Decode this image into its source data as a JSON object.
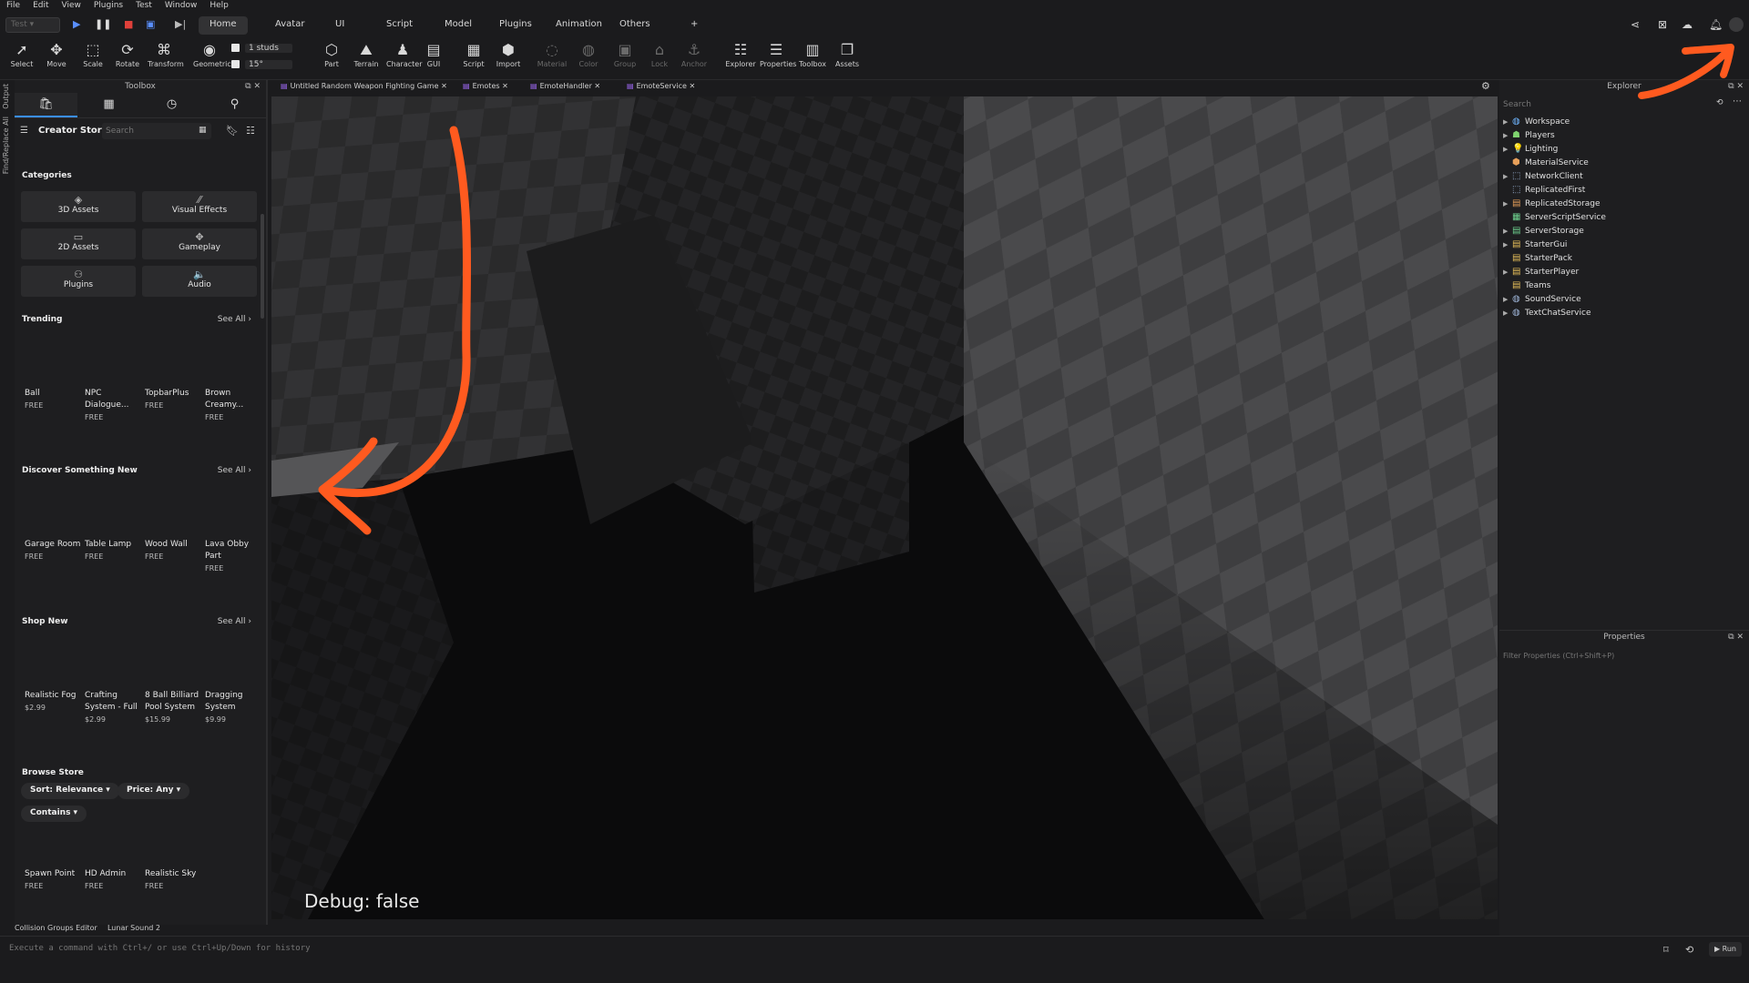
{
  "menu": [
    "File",
    "Edit",
    "View",
    "Plugins",
    "Test",
    "Window",
    "Help"
  ],
  "mode_select": "Test",
  "ribbon_tabs": [
    "Home",
    "Avatar",
    "UI",
    "Script",
    "Model",
    "Plugins",
    "Animation",
    "Others",
    "+"
  ],
  "active_ribbon_tab": "Home",
  "tools": [
    {
      "label": "Select",
      "icon": "select-arrow-icon",
      "glyph": "➚"
    },
    {
      "label": "Move",
      "icon": "move-icon",
      "glyph": "✥"
    },
    {
      "label": "Scale",
      "icon": "scale-icon",
      "glyph": "⬚"
    },
    {
      "label": "Rotate",
      "icon": "rotate-icon",
      "glyph": "⟳"
    },
    {
      "label": "Transform",
      "icon": "transform-icon",
      "glyph": "⌘"
    },
    {
      "label": "Geometric",
      "icon": "geometric-icon",
      "glyph": "◉"
    }
  ],
  "snap": {
    "move": "1 studs",
    "rotate": "15°"
  },
  "tools2": [
    {
      "label": "Part",
      "icon": "part-cube-icon",
      "glyph": "⬡",
      "dim": false
    },
    {
      "label": "Terrain",
      "icon": "terrain-icon",
      "glyph": "⛰",
      "dim": false
    },
    {
      "label": "Character",
      "icon": "character-icon",
      "glyph": "♟",
      "dim": false
    },
    {
      "label": "GUI",
      "icon": "gui-icon",
      "glyph": "▤",
      "dim": false
    },
    {
      "label": "Script",
      "icon": "script-icon",
      "glyph": "▦",
      "dim": false
    },
    {
      "label": "Import",
      "icon": "import-icon",
      "glyph": "⬢",
      "dim": false
    },
    {
      "label": "Material",
      "icon": "material-icon",
      "glyph": "◌",
      "dim": true
    },
    {
      "label": "Color",
      "icon": "color-icon",
      "glyph": "◍",
      "dim": true
    },
    {
      "label": "Group",
      "icon": "group-icon",
      "glyph": "▣",
      "dim": true
    },
    {
      "label": "Lock",
      "icon": "lock-icon",
      "glyph": "⌂",
      "dim": true
    },
    {
      "label": "Anchor",
      "icon": "anchor-icon",
      "glyph": "⚓",
      "dim": true
    },
    {
      "label": "Explorer",
      "icon": "explorer-icon",
      "glyph": "☷",
      "dim": false
    },
    {
      "label": "Properties",
      "icon": "properties-icon",
      "glyph": "☰",
      "dim": false
    },
    {
      "label": "Toolbox",
      "icon": "toolbox-icon",
      "glyph": "▥",
      "dim": false
    },
    {
      "label": "Assets",
      "icon": "assets-icon",
      "glyph": "❐",
      "dim": false
    }
  ],
  "left_rail": [
    "Output",
    "Find/Replace All"
  ],
  "toolbox": {
    "title": "Toolbox",
    "store_title": "Creator Store",
    "search_placeholder": "Search",
    "categories_title": "Categories",
    "categories": [
      {
        "label": "3D Assets",
        "icon": "cube-icon",
        "glyph": "◈"
      },
      {
        "label": "Visual Effects",
        "icon": "sparkle-icon",
        "glyph": "⁄⁄"
      },
      {
        "label": "2D Assets",
        "icon": "image-icon",
        "glyph": "▭"
      },
      {
        "label": "Gameplay",
        "icon": "gameplay-icon",
        "glyph": "✥"
      },
      {
        "label": "Plugins",
        "icon": "plugin-icon",
        "glyph": "⚇"
      },
      {
        "label": "Audio",
        "icon": "audio-icon",
        "glyph": "🔈"
      }
    ],
    "see_all": "See All",
    "sections": [
      {
        "title": "Trending",
        "items": [
          {
            "name": "Ball",
            "price": "FREE"
          },
          {
            "name": "NPC Dialogue...",
            "price": "FREE"
          },
          {
            "name": "TopbarPlus",
            "price": "FREE"
          },
          {
            "name": "Brown Creamy...",
            "price": "FREE"
          }
        ]
      },
      {
        "title": "Discover Something New",
        "items": [
          {
            "name": "Garage Room",
            "price": "FREE"
          },
          {
            "name": "Table Lamp",
            "price": "FREE"
          },
          {
            "name": "Wood Wall",
            "price": "FREE"
          },
          {
            "name": "Lava Obby Part",
            "price": "FREE"
          }
        ]
      },
      {
        "title": "Shop New",
        "items": [
          {
            "name": "Realistic Fog",
            "price": "$2.99"
          },
          {
            "name": "Crafting System - Full",
            "price": "$2.99"
          },
          {
            "name": "8 Ball Billiard Pool System",
            "price": "$15.99"
          },
          {
            "name": "Dragging System",
            "price": "$9.99"
          }
        ]
      }
    ],
    "browse_title": "Browse Store",
    "browse_pills": [
      "Sort: Relevance",
      "Price: Any",
      "Contains"
    ],
    "browse_items": [
      {
        "name": "Spawn Point",
        "price": "FREE"
      },
      {
        "name": "HD Admin",
        "price": "FREE"
      },
      {
        "name": "Realistic Sky",
        "price": "FREE"
      }
    ]
  },
  "bottom_tabs": [
    "Collision Groups Editor",
    "Lunar Sound 2"
  ],
  "command_placeholder": "Execute a command with Ctrl+/ or use Ctrl+Up/Down for history",
  "run_label": "▶ Run",
  "doc_tabs": [
    "Untitled Random Weapon Fighting Game",
    "Emotes",
    "EmoteHandler",
    "EmoteService"
  ],
  "viewport": {
    "debug_text": "Debug: false"
  },
  "explorer": {
    "title": "Explorer",
    "search_placeholder": "Search",
    "items": [
      {
        "label": "Workspace",
        "expandable": true,
        "icon": "workspace-icon",
        "glyph": "◍",
        "color": "#6fb6ff"
      },
      {
        "label": "Players",
        "expandable": true,
        "icon": "players-icon",
        "glyph": "☗",
        "color": "#7fd36f"
      },
      {
        "label": "Lighting",
        "expandable": true,
        "icon": "lighting-icon",
        "glyph": "💡",
        "color": "#f2c94c"
      },
      {
        "label": "MaterialService",
        "expandable": false,
        "icon": "material-service-icon",
        "glyph": "⬢",
        "color": "#e8a05a"
      },
      {
        "label": "NetworkClient",
        "expandable": true,
        "icon": "network-icon",
        "glyph": "⬚",
        "color": "#9fb6d8"
      },
      {
        "label": "ReplicatedFirst",
        "expandable": false,
        "icon": "replicated-first-icon",
        "glyph": "⬚",
        "color": "#9fb6d8"
      },
      {
        "label": "ReplicatedStorage",
        "expandable": true,
        "icon": "replicated-storage-icon",
        "glyph": "▤",
        "color": "#e8a05a"
      },
      {
        "label": "ServerScriptService",
        "expandable": false,
        "icon": "server-script-icon",
        "glyph": "▦",
        "color": "#6fd38f"
      },
      {
        "label": "ServerStorage",
        "expandable": true,
        "icon": "server-storage-icon",
        "glyph": "▤",
        "color": "#6fd38f"
      },
      {
        "label": "StarterGui",
        "expandable": true,
        "icon": "starter-gui-icon",
        "glyph": "▤",
        "color": "#e8c05a"
      },
      {
        "label": "StarterPack",
        "expandable": false,
        "icon": "starter-pack-icon",
        "glyph": "▤",
        "color": "#e8c05a"
      },
      {
        "label": "StarterPlayer",
        "expandable": true,
        "icon": "starter-player-icon",
        "glyph": "▤",
        "color": "#e8c05a"
      },
      {
        "label": "Teams",
        "expandable": false,
        "icon": "teams-icon",
        "glyph": "▤",
        "color": "#e8c05a"
      },
      {
        "label": "SoundService",
        "expandable": true,
        "icon": "sound-service-icon",
        "glyph": "◍",
        "color": "#9fb6d8"
      },
      {
        "label": "TextChatService",
        "expandable": true,
        "icon": "text-chat-icon",
        "glyph": "◍",
        "color": "#9fb6d8"
      }
    ]
  },
  "properties": {
    "title": "Properties",
    "filter_placeholder": "Filter Properties (Ctrl+Shift+P)"
  },
  "colors": {
    "annotation": "#ff5a1f",
    "accent": "#3a8fff"
  }
}
